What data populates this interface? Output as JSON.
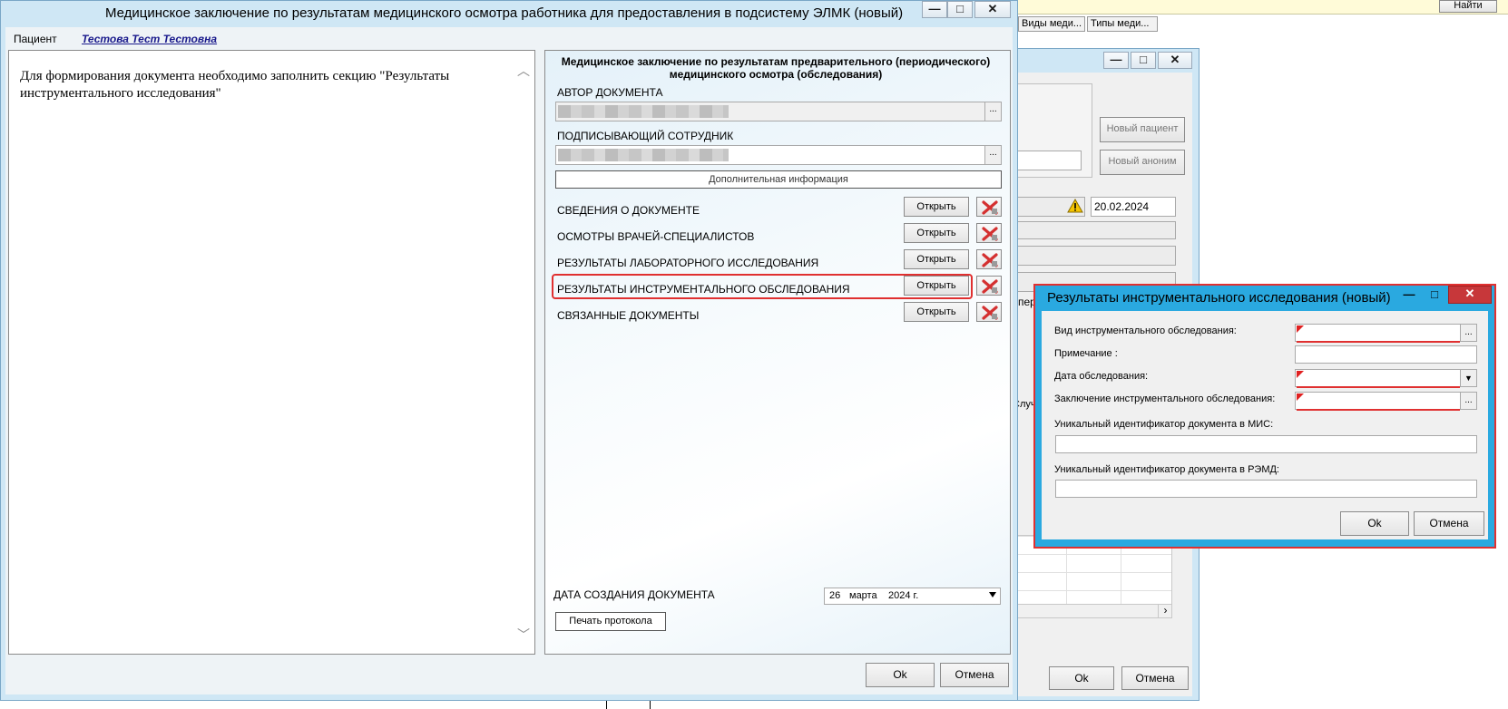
{
  "background": {
    "find_button": "Найти",
    "tab_vidy": "Виды меди...",
    "tab_tipy": "Типы меди...",
    "new_patient": "Новый пациент",
    "new_anonymous": "Новый аноним",
    "date_value": "20.02.2024",
    "partial_text_1": "пер",
    "partial_text_2": "Случа",
    "ok": "Ok",
    "cancel": "Отмена"
  },
  "main_window": {
    "title": "Медицинское заключение по результатам медицинского осмотра работника для предоставления в подсистему ЭЛМК (новый)",
    "patient_label": "Пациент",
    "patient_name": "Тестова Тест Тестовна",
    "message": "Для формирования документа необходимо заполнить секцию \"Результаты инструментального исследования\"",
    "form_title": "Медицинское заключение по результатам предварительного (периодического) медицинского осмотра (обследования)",
    "author_label": "АВТОР ДОКУМЕНТА",
    "signer_label": "ПОДПИСЫВАЮЩИЙ СОТРУДНИК",
    "extra_info": "Дополнительная информация",
    "sections": [
      {
        "label": "СВЕДЕНИЯ О ДОКУМЕНТЕ",
        "button": "Открыть"
      },
      {
        "label": "ОСМОТРЫ ВРАЧЕЙ-СПЕЦИАЛИСТОВ",
        "button": "Открыть"
      },
      {
        "label": "РЕЗУЛЬТАТЫ ЛАБОРАТОРНОГО ИССЛЕДОВАНИЯ",
        "button": "Открыть"
      },
      {
        "label": "РЕЗУЛЬТАТЫ ИНСТРУМЕНТАЛЬНОГО ОБСЛЕДОВАНИЯ",
        "button": "Открыть"
      },
      {
        "label": "СВЯЗАННЫЕ ДОКУМЕНТЫ",
        "button": "Открыть"
      }
    ],
    "creation_date_label": "ДАТА СОЗДАНИЯ ДОКУМЕНТА",
    "date_day": "26",
    "date_month": "марта",
    "date_year": "2024 г.",
    "print_button": "Печать протокола",
    "ok": "Ok",
    "cancel": "Отмена",
    "min_glyph": "—",
    "max_glyph": "□",
    "close_glyph": "✕",
    "dots": "..."
  },
  "dialog": {
    "title": "Результаты инструментального исследования (новый)",
    "field_type_label": "Вид инструментального обследования:",
    "field_note_label": "Примечание :",
    "field_date_label": "Дата обследования:",
    "field_conclusion_label": "Заключение инструментального обследования:",
    "field_mis_label": "Уникальный идентификатор документа в МИС:",
    "field_remd_label": "Уникальный идентификатор документа в РЭМД:",
    "ok": "Ok",
    "cancel": "Отмена",
    "dots": "...",
    "dropdown_glyph": "▼"
  },
  "colors": {
    "highlight_red": "#e03030",
    "link_blue": "#1a1a8c",
    "dialog_frame": "#2aa9e0"
  }
}
